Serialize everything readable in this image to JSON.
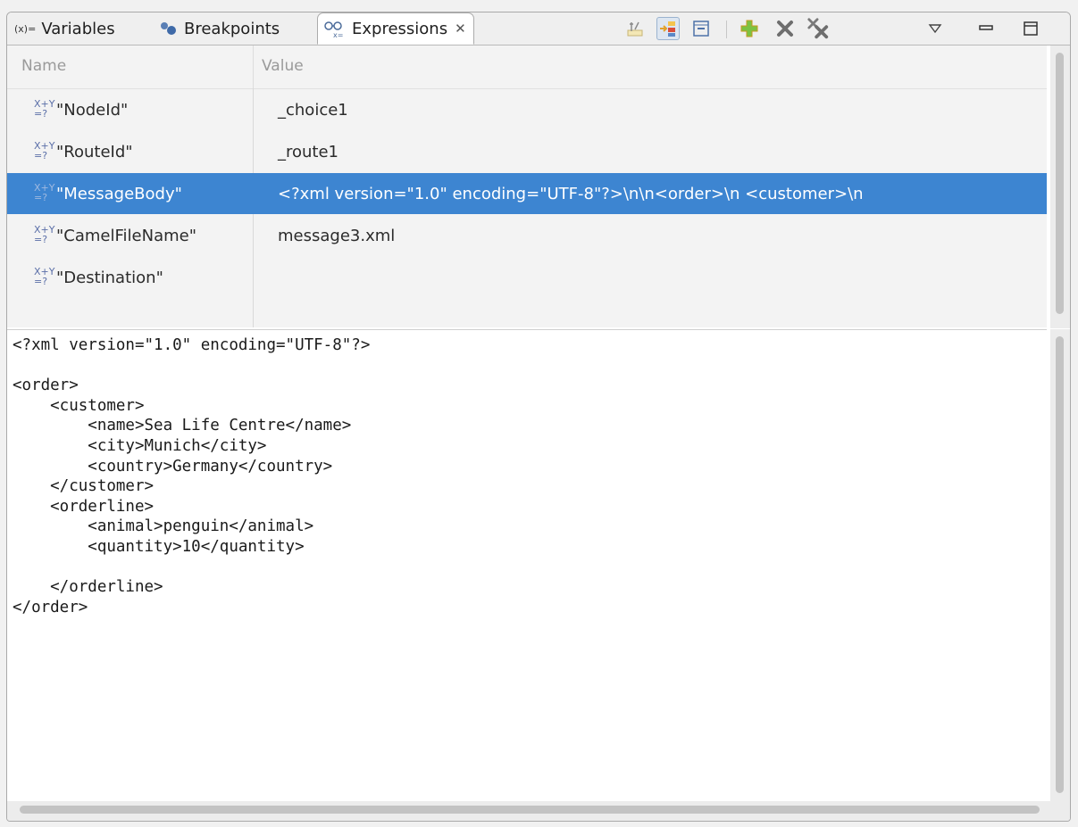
{
  "tabs": [
    {
      "label": "Variables",
      "icon": "variables-icon",
      "prefix": "(x)="
    },
    {
      "label": "Breakpoints",
      "icon": "breakpoints-icon"
    },
    {
      "label": "Expressions",
      "icon": "expressions-icon",
      "active": true
    }
  ],
  "toolbar": {
    "icons": [
      "show-type-names-icon",
      "show-logical-structure-icon",
      "collapse-all-icon",
      "add-expression-icon",
      "remove-expression-icon",
      "remove-all-expressions-icon",
      "view-menu-icon",
      "minimize-icon",
      "maximize-icon"
    ]
  },
  "table": {
    "headers": {
      "name": "Name",
      "value": "Value"
    },
    "rows": [
      {
        "name": "\"NodeId\"",
        "value": "_choice1"
      },
      {
        "name": "\"RouteId\"",
        "value": "_route1"
      },
      {
        "name": "\"MessageBody\"",
        "value": "<?xml version=\"1.0\" encoding=\"UTF-8\"?>\\n\\n<order>\\n    <customer>\\n",
        "selected": true
      },
      {
        "name": "\"CamelFileName\"",
        "value": "message3.xml"
      },
      {
        "name": "\"Destination\"",
        "value": ""
      }
    ],
    "expr_icon": {
      "top": "X+Y",
      "bottom": "=?"
    }
  },
  "detail": {
    "text": "<?xml version=\"1.0\" encoding=\"UTF-8\"?>\n\n<order>\n    <customer>\n        <name>Sea Life Centre</name>\n        <city>Munich</city>\n        <country>Germany</country>\n    </customer>\n    <orderline>\n        <animal>penguin</animal>\n        <quantity>10</quantity>\n\n    </orderline>\n</order>"
  },
  "colors": {
    "selection": "#3d85d1",
    "add": "#7cc242",
    "remove": "#6e6e6e"
  }
}
